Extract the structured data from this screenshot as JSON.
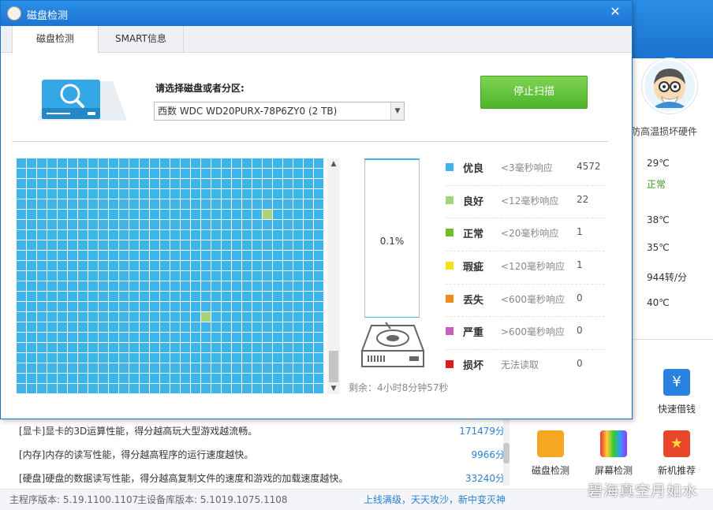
{
  "background": {
    "side_heading": "防高温损坏硬件",
    "side_values": [
      {
        "text": "29℃",
        "status": "normal-text"
      },
      {
        "text": "正常",
        "status": "green"
      },
      {
        "text": "38℃",
        "status": "normal-text"
      },
      {
        "text": "35℃",
        "status": "normal-text"
      },
      {
        "text": "944转/分",
        "status": "normal-text"
      },
      {
        "text": "40℃",
        "status": "normal-text"
      }
    ],
    "tools": [
      {
        "label": "快速借钱",
        "icon": "money-icon"
      },
      {
        "label": "磁盘检测",
        "icon": "disk-icon"
      },
      {
        "label": "屏幕检测",
        "icon": "monitor-icon"
      },
      {
        "label": "新机推荐",
        "icon": "star-badge-icon"
      }
    ],
    "score_list": [
      {
        "text": "[显卡]显卡的3D运算性能，得分越高玩大型游戏越流畅。",
        "score": "171479分"
      },
      {
        "text": "[内存]内存的读写性能，得分越高程序的运行速度越快。",
        "score": "9966分"
      },
      {
        "text": "[硬盘]硬盘的数据读写性能，得分越高复制文件的速度和游戏的加载速度越快。",
        "score": "33240分"
      }
    ],
    "status_bar": {
      "main_version": "主程序版本: 5.19.1100.1107",
      "db_version": "主设备库版本: 5.1019.1075.1108",
      "slogan": "上线满级，天天攻沙，新中变灭神"
    },
    "watermark": "碧海真空月如水"
  },
  "dialog": {
    "title": "磁盘检测",
    "close_glyph": "✕",
    "tabs": [
      {
        "label": "磁盘检测",
        "active": true
      },
      {
        "label": "SMART信息",
        "active": false
      }
    ],
    "select_label": "请选择磁盘或者分区:",
    "selected_disk": "西数 WDC WD20PURX-78P6ZY0  (2 TB)",
    "stop_button": "停止扫描",
    "progress": {
      "text": "0.1%",
      "value": 0.001
    },
    "remaining": "剩余：4小时8分钟57秒",
    "grid": {
      "columns": 30,
      "rows": 23,
      "good_cells": [
        [
          5,
          24
        ],
        [
          15,
          18
        ]
      ]
    },
    "legend": [
      {
        "name": "优良",
        "desc": "<3毫秒响应",
        "count": "4572",
        "color": "#3db4ea"
      },
      {
        "name": "良好",
        "desc": "<12毫秒响应",
        "count": "22",
        "color": "#a6d27a"
      },
      {
        "name": "正常",
        "desc": "<20毫秒响应",
        "count": "1",
        "color": "#6cbe2c"
      },
      {
        "name": "瑕疵",
        "desc": "<120毫秒响应",
        "count": "1",
        "color": "#f5e21c"
      },
      {
        "name": "丢失",
        "desc": "<600毫秒响应",
        "count": "0",
        "color": "#f08a1d"
      },
      {
        "name": "严重",
        "desc": ">600毫秒响应",
        "count": "0",
        "color": "#c55fc4"
      },
      {
        "name": "损坏",
        "desc": "无法读取",
        "count": "0",
        "color": "#e01b1b"
      }
    ]
  }
}
